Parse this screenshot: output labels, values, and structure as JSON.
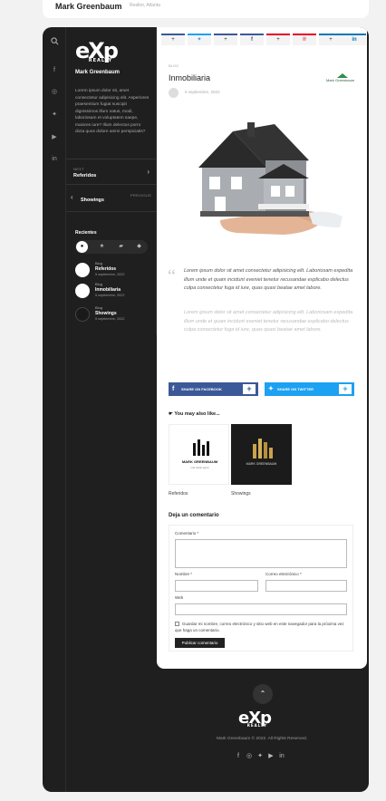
{
  "topbar": {
    "name": "Mark Greenbaum",
    "sub": "Realtor, Atlanta"
  },
  "sidebar": {
    "logo": "eXp",
    "logo_sub": "REALTY",
    "name": "Mark Greenbaum",
    "bio": "Lorem ipsum dolor sit, amet consectetur adipisicing elit. Asperiores praesentium fugiat suscipit dignissimos illum natus, modi, laboriosam et voluptatem saepe, maiores iure? Illum delectus porro dicta quos dolore animi perspiciatis?",
    "next": {
      "tag": "NEXT",
      "label": "Referidos"
    },
    "previous": {
      "tag": "PREVIOUS",
      "label": "Showings"
    },
    "recent_title": "Recientes",
    "recent": [
      {
        "cat": "Blog",
        "title": "Referidos",
        "date": "5 septiembre, 2022"
      },
      {
        "cat": "Blog",
        "title": "Inmobiliaria",
        "date": "5 septiembre, 2022"
      },
      {
        "cat": "Blog",
        "title": "Showings",
        "date": "5 septiembre, 2022"
      }
    ]
  },
  "post": {
    "category": "BLOG",
    "title": "Inmobiliaria",
    "date": "5 septiembre, 2022",
    "mini_logo": "Mark Greenbaum",
    "quote": "Lorem ipsum dolor sit amet consectetur adipisicing elit. Laboriosam expedita illum unde et quam incidunt eveniet tenetur recusandae explicabo delectus culpa consectetur fuga id iure, quas quasi beatae amet labore.",
    "quote_faded": "Lorem ipsum dolor sit amet consectetur adipisicing elit. Laboriosam expedita illum unde et quam incidunt eveniet tenetur recusandae explicabo delectus culpa consectetur fuga id iure, quas quasi beatae amet labore."
  },
  "share": {
    "facebook": "SHARE ON FACEBOOK",
    "twitter": "SHARE ON TWITTER",
    "plus": "+"
  },
  "related": {
    "title": "You may also like...",
    "items": [
      {
        "caption": "Referidos",
        "thumb_text": "MARK GREENBAUM",
        "thumb_sub": "real estate agent"
      },
      {
        "caption": "Showings",
        "thumb_text": "MARK GREENBAUM"
      }
    ]
  },
  "comments": {
    "title": "Deja un comentario",
    "comment_label": "Comentario *",
    "name_label": "Nombre *",
    "email_label": "Correo electrónico *",
    "web_label": "Web",
    "consent": "Guardar mi nombre, correo electrónico y sitio web en este navegador para la próxima vez que haga un comentario.",
    "submit": "Publicar comentario"
  },
  "footer": {
    "logo": "eXp",
    "logo_sub": "REALTY",
    "copyright": "Mark Greenbaum © 2022. All Rights Reserved."
  },
  "colors": {
    "facebook": "#3b5998",
    "twitter": "#1da1f2",
    "pinterest": "#e60023",
    "linkedin": "#0077b5"
  }
}
